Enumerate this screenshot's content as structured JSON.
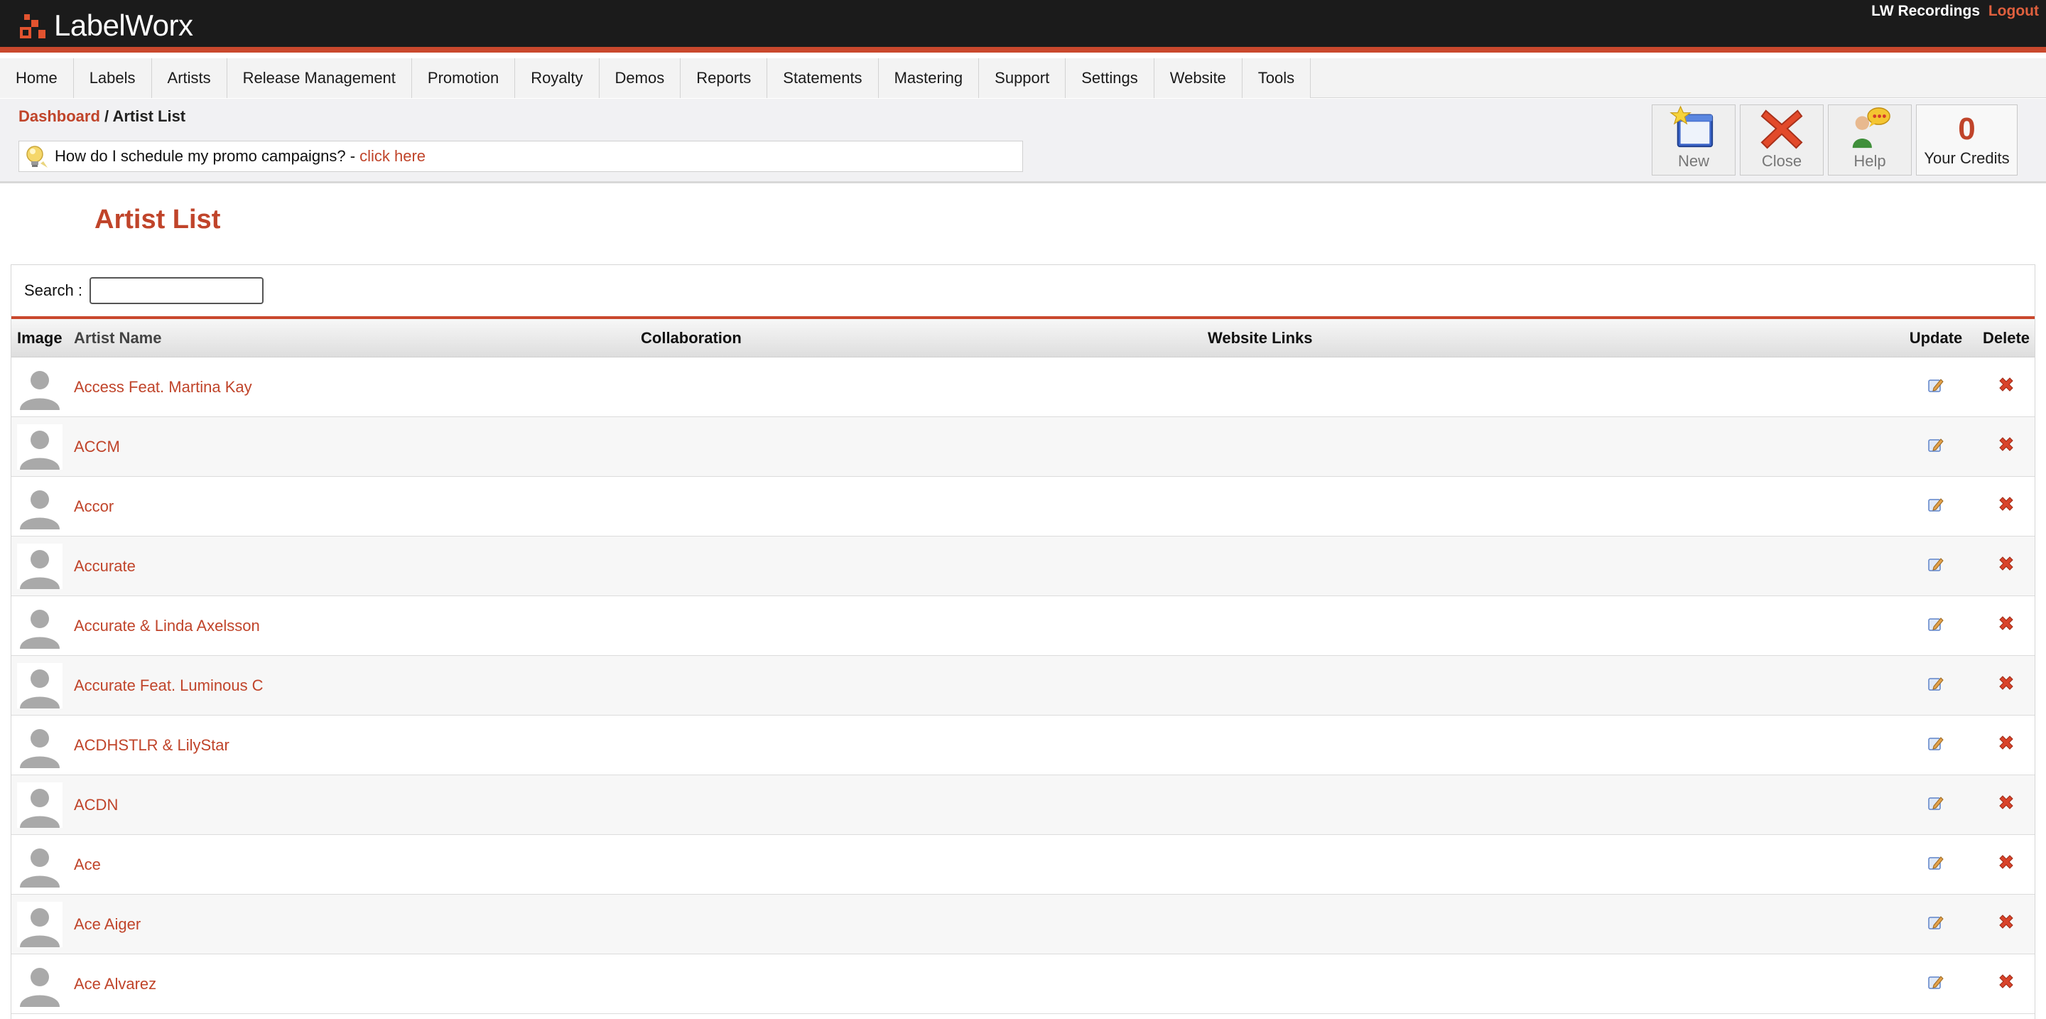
{
  "header": {
    "brand": "LabelWorx",
    "user_name": "LW Recordings",
    "logout_label": "Logout",
    "accent_color": "#c9482d"
  },
  "nav": {
    "items": [
      "Home",
      "Labels",
      "Artists",
      "Release Management",
      "Promotion",
      "Royalty",
      "Demos",
      "Reports",
      "Statements",
      "Mastering",
      "Support",
      "Settings",
      "Website",
      "Tools"
    ]
  },
  "breadcrumb": {
    "root": "Dashboard",
    "separator": " / ",
    "current": "Artist List"
  },
  "tip": {
    "icon": "lightbulb-icon",
    "text": "How do I schedule my promo campaigns? -",
    "link": "click here"
  },
  "toolbar": {
    "new_label": "New",
    "close_label": "Close",
    "help_label": "Help",
    "credits_value": "0",
    "credits_label": "Your Credits"
  },
  "page": {
    "title": "Artist List"
  },
  "search": {
    "label": "Search :",
    "value": ""
  },
  "table": {
    "columns": {
      "image": "Image",
      "name": "Artist Name",
      "collaboration": "Collaboration",
      "website": "Website Links",
      "update": "Update",
      "delete": "Delete"
    },
    "rows": [
      {
        "name": "Access Feat. Martina Kay"
      },
      {
        "name": "ACCM"
      },
      {
        "name": "Accor"
      },
      {
        "name": "Accurate"
      },
      {
        "name": "Accurate & Linda Axelsson"
      },
      {
        "name": "Accurate Feat. Luminous C"
      },
      {
        "name": "ACDHSTLR & LilyStar"
      },
      {
        "name": "ACDN"
      },
      {
        "name": "Ace"
      },
      {
        "name": "Ace Aiger"
      },
      {
        "name": "Ace Alvarez"
      }
    ]
  }
}
